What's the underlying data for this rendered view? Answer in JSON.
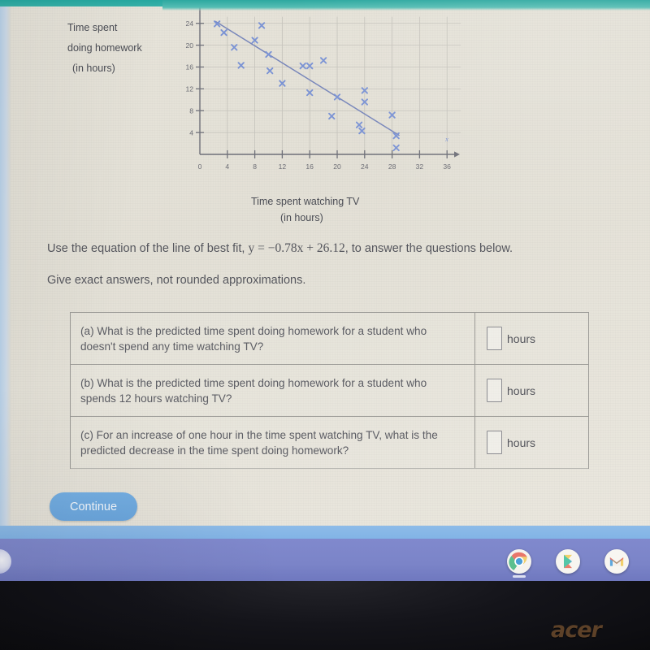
{
  "device": {
    "brand_logo": "acer",
    "shelf": {
      "launcher_name": "launcher-button",
      "icons": [
        {
          "name": "chrome-icon",
          "label": "Chrome"
        },
        {
          "name": "play-store-icon",
          "label": "Play Store"
        },
        {
          "name": "gmail-icon",
          "label": "Gmail"
        }
      ]
    },
    "colors": {
      "shelf": "#7b84c8",
      "blue_band": "#82b4e6",
      "bezel": "#14141a",
      "acer_logo": "#6b4a2c",
      "teal_strip": "#2da8a0",
      "page": "#e5e2d8"
    }
  },
  "chart_labels": {
    "y_caption_line1": "Time spent",
    "y_caption_line2": "doing homework",
    "y_caption_line3": "(in hours)",
    "x_caption_line1": "Time spent watching TV",
    "x_caption_line2": "(in hours)",
    "x_axis_var": "x"
  },
  "chart_data": {
    "type": "scatter",
    "title": "",
    "xlabel": "Time spent watching TV (in hours)",
    "ylabel": "Time spent doing homework (in hours)",
    "xlim": [
      0,
      38
    ],
    "ylim": [
      0,
      25
    ],
    "xticks": [
      0,
      4,
      8,
      12,
      16,
      20,
      24,
      28,
      32,
      36
    ],
    "yticks": [
      4,
      8,
      12,
      16,
      20,
      24
    ],
    "grid": true,
    "marker": "x",
    "marker_color": "#7b93d4",
    "line_color": "#6f7fb8",
    "points": [
      [
        2.5,
        23.9
      ],
      [
        3.5,
        22.3
      ],
      [
        5.0,
        19.6
      ],
      [
        6.0,
        16.3
      ],
      [
        8.0,
        20.9
      ],
      [
        9.0,
        23.6
      ],
      [
        10.0,
        18.3
      ],
      [
        10.2,
        15.3
      ],
      [
        12.0,
        13.0
      ],
      [
        15.0,
        16.2
      ],
      [
        16.0,
        16.2
      ],
      [
        16.0,
        11.3
      ],
      [
        18.0,
        17.2
      ],
      [
        19.2,
        7.0
      ],
      [
        20.0,
        10.5
      ],
      [
        23.2,
        5.4
      ],
      [
        23.6,
        4.3
      ],
      [
        24.0,
        11.7
      ],
      [
        24.0,
        9.6
      ],
      [
        28.0,
        7.2
      ],
      [
        28.6,
        3.4
      ],
      [
        28.6,
        1.2
      ]
    ],
    "best_fit_line": {
      "equation": "y = -0.78x + 26.12",
      "slope": -0.78,
      "intercept": 26.12,
      "x_from": 2.3,
      "x_to": 29.0
    }
  },
  "prompt": {
    "line1_pre": "Use the equation of the line of best fit, ",
    "equation": "y = −0.78x + 26.12",
    "line1_post": ", to answer the questions below.",
    "line2": "Give exact answers, not rounded approximations."
  },
  "questions": [
    {
      "label": "(a) What is the predicted time spent doing homework for a student who doesn't spend any time watching TV?",
      "answer_value": "",
      "unit": "hours"
    },
    {
      "label": "(b) What is the predicted time spent doing homework for a student who spends 12 hours watching TV?",
      "answer_value": "",
      "unit": "hours"
    },
    {
      "label": "(c) For an increase of one hour in the time spent watching TV, what is the predicted decrease in the time spent doing homework?",
      "answer_value": "",
      "unit": "hours"
    }
  ],
  "actions": {
    "continue_label": "Continue"
  }
}
